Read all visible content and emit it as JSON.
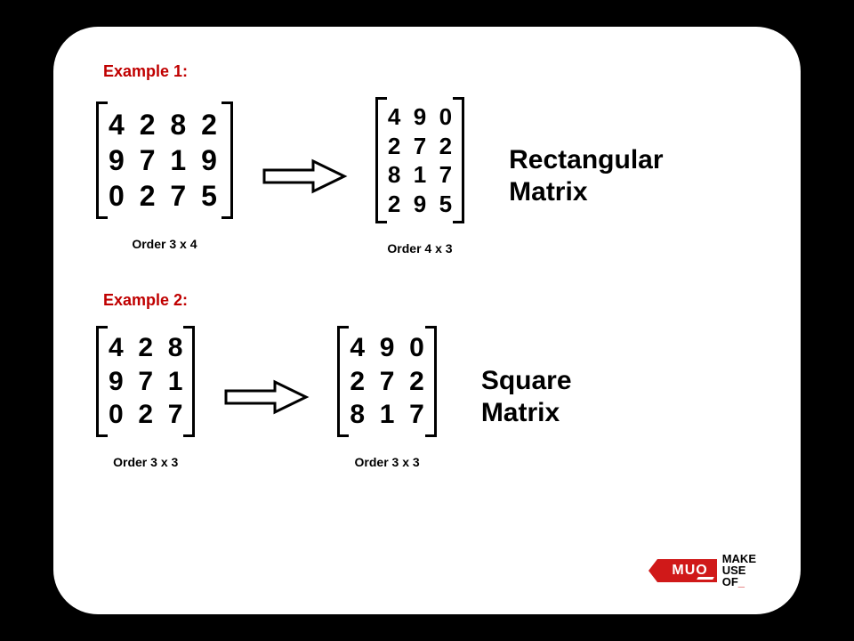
{
  "examples": [
    {
      "label": "Example 1:",
      "left": {
        "rows": [
          "4 2 8 2",
          "9 7 1 9",
          "0 2 7 5"
        ],
        "order": "Order 3 x 4"
      },
      "right": {
        "rows": [
          "4  9  0",
          "2  7  2",
          "8  1  7",
          "2  9  5"
        ],
        "order": "Order 4 x 3"
      },
      "type": "Rectangular\nMatrix"
    },
    {
      "label": "Example 2:",
      "left": {
        "rows": [
          "4  2  8",
          "9  7  1",
          "0  2  7"
        ],
        "order": "Order 3 x 3"
      },
      "right": {
        "rows": [
          "4  9  0",
          "2  7  2",
          "8  1  7"
        ],
        "order": "Order 3 x 3"
      },
      "type": "Square\nMatrix"
    }
  ],
  "logo": {
    "badge": "MUO",
    "line1": "MAKE",
    "line2": "USE",
    "line3": "OF"
  }
}
